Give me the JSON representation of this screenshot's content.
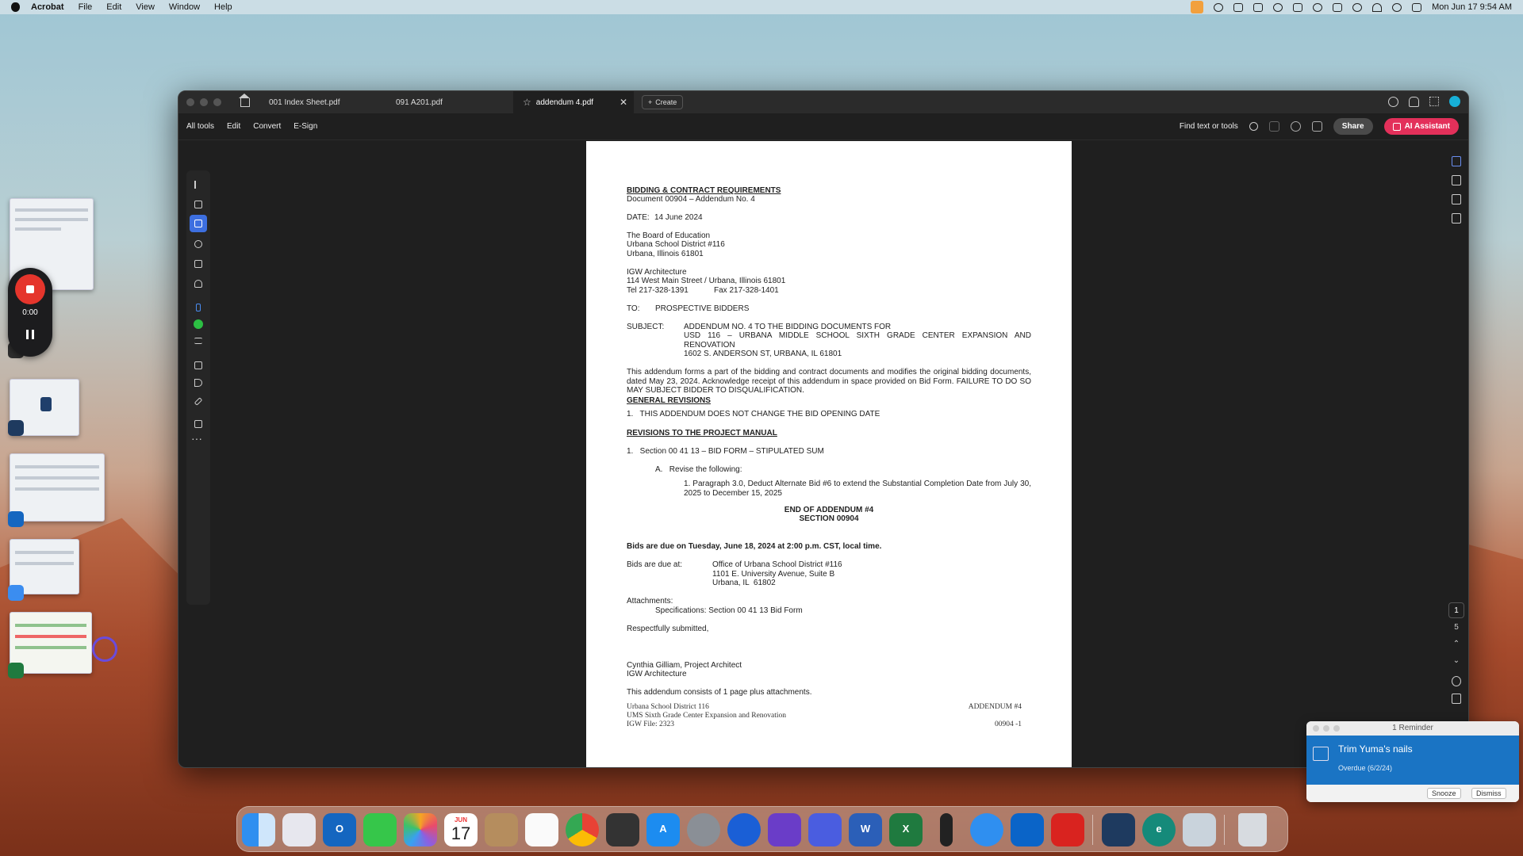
{
  "menubar": {
    "app_name": "Acrobat",
    "items": [
      "File",
      "Edit",
      "View",
      "Window",
      "Help"
    ],
    "clock": "Mon Jun 17  9:54 AM"
  },
  "recorder": {
    "time": "0:00"
  },
  "acrobat": {
    "tabs": [
      {
        "label": "001 Index Sheet.pdf",
        "active": false
      },
      {
        "label": "091 A201.pdf",
        "active": false
      },
      {
        "label": "addendum 4.pdf",
        "active": true
      }
    ],
    "create_label": "Create",
    "toolbar_menus": [
      "All tools",
      "Edit",
      "Convert",
      "E-Sign"
    ],
    "find_label": "Find text or tools",
    "share_label": "Share",
    "ai_label": "AI Assistant",
    "page_current": "1",
    "page_total": "5"
  },
  "document": {
    "heading": "BIDDING & CONTRACT REQUIREMENTS",
    "doc_line": "Document 00904 – Addendum No. 4",
    "date_label": "DATE:",
    "date_value": "14 June 2024",
    "board": [
      "The Board of Education",
      "Urbana School District #116",
      "Urbana, Illinois 61801"
    ],
    "architect": [
      "IGW Architecture",
      "114 West Main Street / Urbana, Illinois 61801"
    ],
    "tel": "Tel 217-328-1391",
    "fax": "Fax 217-328-1401",
    "to_label": "TO:",
    "to_value": "PROSPECTIVE BIDDERS",
    "subject_label": "SUBJECT:",
    "subject_lines": [
      "ADDENDUM NO. 4 TO THE BIDDING DOCUMENTS FOR",
      "USD 116 – URBANA MIDDLE SCHOOL SIXTH GRADE CENTER EXPANSION AND RENOVATION",
      "1602 S. ANDERSON ST, URBANA, IL 61801"
    ],
    "intro": "This addendum forms a part of the bidding and contract documents and modifies the original bidding documents, dated May 23, 2024. Acknowledge receipt of this addendum in space provided on Bid Form. FAILURE TO DO SO MAY SUBJECT BIDDER TO DISQUALIFICATION.",
    "general_heading": "GENERAL REVISIONS",
    "general_item": "1.   THIS ADDENDUM DOES NOT CHANGE THE BID OPENING DATE",
    "manual_heading": "REVISIONS TO THE PROJECT MANUAL",
    "manual_item": "1.   Section 00 41 13 – BID FORM – STIPULATED SUM",
    "revise_item": "A.   Revise the following:",
    "para_item": "1.   Paragraph 3.0, Deduct Alternate Bid #6 to extend the Substantial Completion Date from July 30, 2025 to December 15, 2025",
    "end_line1": "END OF ADDENDUM #4",
    "end_line2": "SECTION 00904",
    "bids_due_bold": "Bids are due on Tuesday, June 18, 2024 at 2:00 p.m. CST, local time.",
    "bids_due_label": "Bids are due at:",
    "bids_due_address": [
      "Office of Urbana School District #116",
      "1101 E. University Avenue, Suite B",
      "Urbana, IL  61802"
    ],
    "attachments_label": "Attachments:",
    "attachments_item": "Specifications: Section 00 41 13 Bid Form",
    "closing": "Respectfully submitted,",
    "signer": "Cynthia Gilliam, Project Architect",
    "signer_firm": "IGW Architecture",
    "consists": "This addendum consists of 1 page plus attachments.",
    "footer_left": [
      "Urbana School District 116",
      "UMS Sixth Grade Center Expansion and Renovation",
      "IGW File: 2323"
    ],
    "footer_right": [
      "ADDENDUM #4",
      "00904 -1"
    ]
  },
  "reminder": {
    "header": "1 Reminder",
    "title": "Trim Yuma's nails",
    "subtitle": "Overdue (6/2/24)",
    "snooze": "Snooze",
    "dismiss": "Dismiss"
  },
  "dock": {
    "calendar_month": "JUN",
    "calendar_day": "17",
    "apps": [
      "finder",
      "launchpad",
      "outlook",
      "messages",
      "photos",
      "calendar",
      "contacts",
      "reminders",
      "chrome",
      "calculator",
      "app-store",
      "system-settings",
      "1password",
      "screen-recorder",
      "perplexity",
      "word",
      "excel",
      "terminal",
      "safari",
      "onedrive",
      "acrobat",
      "bitwarden",
      "edge-e",
      "preview",
      "trash"
    ]
  }
}
